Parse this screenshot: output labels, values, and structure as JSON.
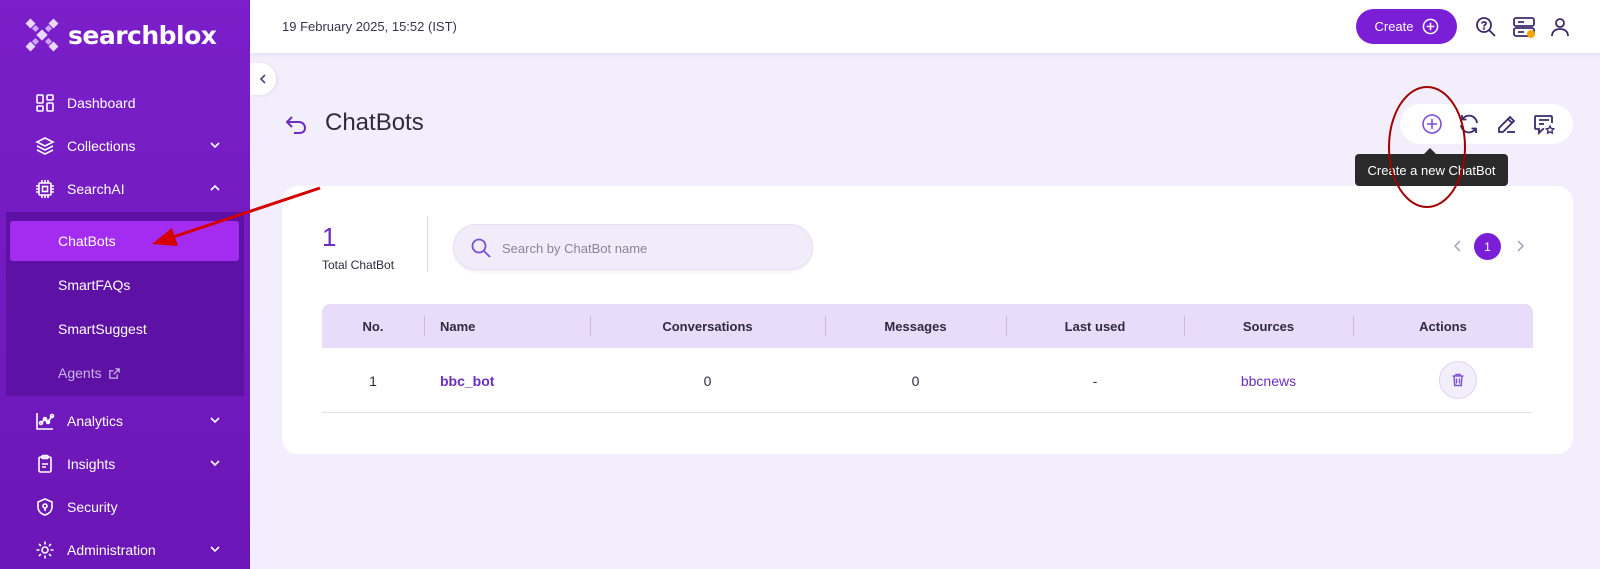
{
  "app": {
    "brand": "searchblox",
    "colors": {
      "accent": "#7b1fd6",
      "sidebar": "#6b16b6",
      "active": "#a42cf0"
    }
  },
  "sidebar": {
    "items": [
      {
        "label": "Dashboard",
        "icon": "dashboard-icon"
      },
      {
        "label": "Collections",
        "icon": "layers-icon"
      },
      {
        "label": "SearchAI",
        "icon": "chip-icon"
      },
      {
        "label": "Analytics",
        "icon": "chart-icon"
      },
      {
        "label": "Insights",
        "icon": "clipboard-icon"
      },
      {
        "label": "Security",
        "icon": "shield-icon"
      },
      {
        "label": "Administration",
        "icon": "gear-icon"
      }
    ],
    "searchai_sub": [
      {
        "label": "ChatBots",
        "active": true
      },
      {
        "label": "SmartFAQs"
      },
      {
        "label": "SmartSuggest"
      },
      {
        "label": "Agents",
        "icon": "external-link-icon"
      }
    ]
  },
  "topbar": {
    "datetime": "19 February 2025, 15:52 (IST)",
    "create_label": "Create"
  },
  "page": {
    "title": "ChatBots",
    "tooltip": "Create a new ChatBot"
  },
  "summary": {
    "total": "1",
    "total_label": "Total ChatBot"
  },
  "search": {
    "placeholder": "Search by ChatBot name",
    "value": ""
  },
  "pagination": {
    "current": "1"
  },
  "table": {
    "columns": [
      "No.",
      "Name",
      "Conversations",
      "Messages",
      "Last used",
      "Sources",
      "Actions"
    ],
    "rows": [
      {
        "no": "1",
        "name": "bbc_bot",
        "conversations": "0",
        "messages": "0",
        "last_used": "-",
        "sources": "bbcnews"
      }
    ]
  }
}
